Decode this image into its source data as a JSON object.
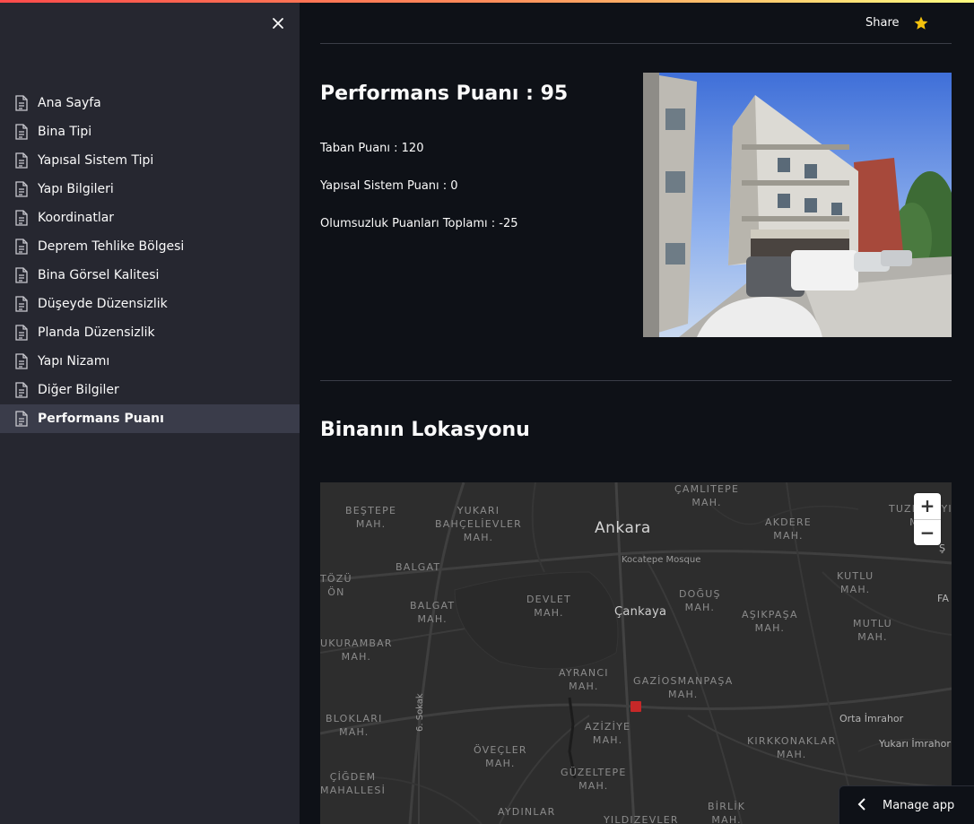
{
  "sidebar": {
    "items": [
      {
        "label": "Ana Sayfa"
      },
      {
        "label": "Bina Tipi"
      },
      {
        "label": "Yapısal Sistem Tipi"
      },
      {
        "label": "Yapı Bilgileri"
      },
      {
        "label": "Koordinatlar"
      },
      {
        "label": "Deprem Tehlike Bölgesi"
      },
      {
        "label": "Bina Görsel Kalitesi"
      },
      {
        "label": "Düşeyde Düzensizlik"
      },
      {
        "label": "Planda Düzensizlik"
      },
      {
        "label": "Yapı Nizamı"
      },
      {
        "label": "Diğer Bilgiler"
      },
      {
        "label": "Performans Puanı"
      }
    ],
    "active_index": 11
  },
  "header": {
    "share_label": "Share"
  },
  "main": {
    "performance_title": "Performans Puanı : 95",
    "stats": [
      "Taban Puanı : 120",
      "Yapısal Sistem Puanı : 0",
      "Olumsuzluk Puanları Toplamı : -25"
    ],
    "location_title": "Binanın Lokasyonu"
  },
  "map": {
    "city": "Ankara",
    "district": "Çankaya",
    "poi": "Kocatepe Mosque",
    "labels": [
      "ÇAMLITEPE\nMAH.",
      "BEŞTEPE\nMAH.",
      "YUKARI\nBAHÇELİEVLER\nMAH.",
      "AKDERE\nMAH.",
      "TUZLUÇAYIR\nMAH.",
      "TÖZÜ\nÖN",
      "BALGAT",
      "KUTLU\nMAH.",
      "DEVLET\nMAH.",
      "DOĞUŞ\nMAH.",
      "BALGAT\nMAH.",
      "AŞIKPAŞA\nMAH.",
      "MUTLU\nMAH.",
      "UKURAMBAR\nMAH.",
      "AYRANCI\nMAH.",
      "GAZİOSMANPAŞA\nMAH.",
      "BLOKLARI\nMAH.",
      "AZİZİYE\nMAH.",
      "KIRKKONAKLAR\nMAH.",
      "ÖVEÇLER\nMAH.",
      "ÇİĞDEM\nMAHALLESİ",
      "GÜZELTEPE\nMAH.",
      "BİRLİK\nMAH.",
      "AYDINLAR",
      "YILDIZEVLER"
    ],
    "towns": [
      "Orta İmrahor",
      "Yukarı İmrahor"
    ],
    "street": "6. Sokak",
    "zoom_in": "+",
    "zoom_out": "−",
    "edge_letters": [
      "Ş",
      "FA"
    ]
  },
  "footer": {
    "manage_label": "Manage app"
  },
  "colors": {
    "accent_gradient": [
      "#ff4b4b",
      "#fffd80"
    ],
    "star": "#f4c20d",
    "marker": "#c62828"
  }
}
